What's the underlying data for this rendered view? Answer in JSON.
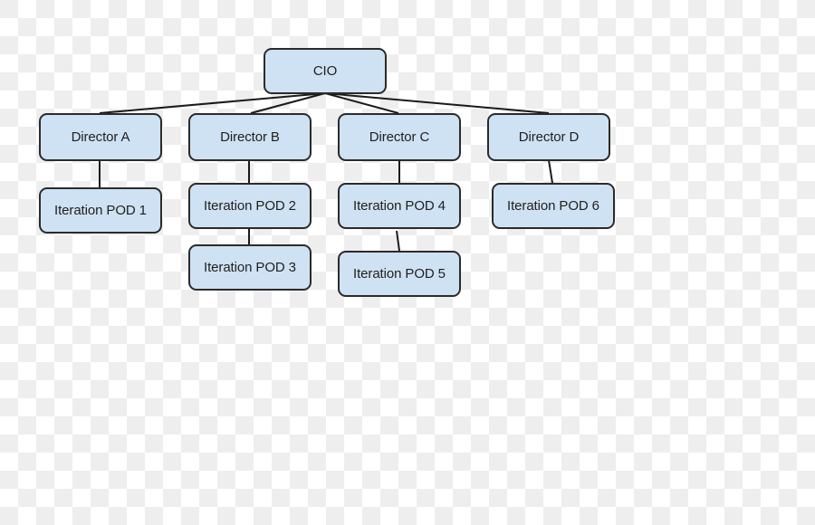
{
  "diagram": {
    "type": "org-chart",
    "colors": {
      "node_fill": "#cfe2f3",
      "node_border": "#2b2b2b",
      "connector": "#1a1a1a",
      "text": "#1f1f1f"
    },
    "nodes": {
      "cio": {
        "label": "CIO"
      },
      "dirA": {
        "label": "Director A"
      },
      "dirB": {
        "label": "Director B"
      },
      "dirC": {
        "label": "Director C"
      },
      "dirD": {
        "label": "Director D"
      },
      "pod1": {
        "label": "Iteration POD 1"
      },
      "pod2": {
        "label": "Iteration POD 2"
      },
      "pod3": {
        "label": "Iteration POD 3"
      },
      "pod4": {
        "label": "Iteration POD 4"
      },
      "pod5": {
        "label": "Iteration POD 5"
      },
      "pod6": {
        "label": "Iteration POD 6"
      }
    },
    "edges": [
      {
        "from": "cio",
        "to": "dirA"
      },
      {
        "from": "cio",
        "to": "dirB"
      },
      {
        "from": "cio",
        "to": "dirC"
      },
      {
        "from": "cio",
        "to": "dirD"
      },
      {
        "from": "dirA",
        "to": "pod1"
      },
      {
        "from": "dirB",
        "to": "pod2"
      },
      {
        "from": "pod2",
        "to": "pod3"
      },
      {
        "from": "dirC",
        "to": "pod4"
      },
      {
        "from": "pod4",
        "to": "pod5"
      },
      {
        "from": "dirD",
        "to": "pod6"
      }
    ]
  }
}
